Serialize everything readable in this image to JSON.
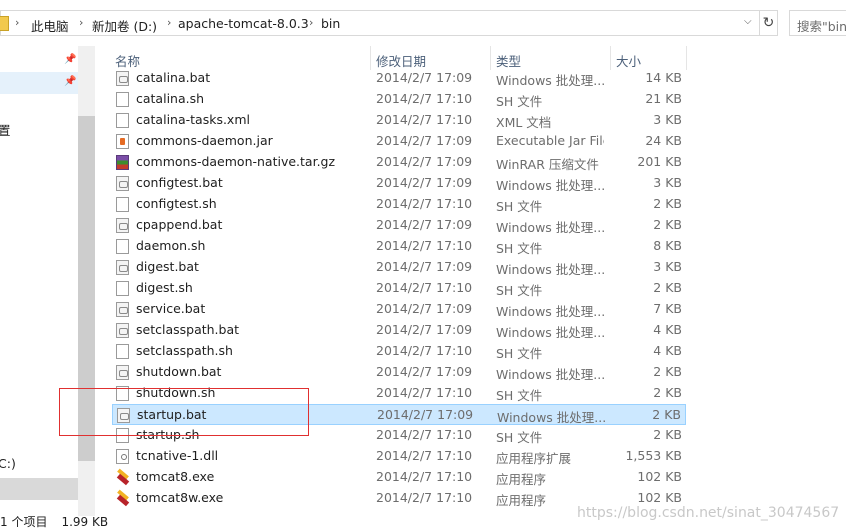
{
  "address": {
    "crumbs": [
      "此电脑",
      "新加卷 (D:)",
      "apache-tomcat-8.0.3",
      "bin"
    ],
    "refresh_glyph": "↻",
    "dropdown_glyph": "⌵",
    "search_placeholder": "搜索\"bin\""
  },
  "nav": {
    "items": [
      {
        "label": "",
        "pinned": true
      },
      {
        "label": "",
        "pinned": true
      },
      {
        "label": "置",
        "pinned": false
      },
      {
        "label": "C:)",
        "pinned": false
      },
      {
        "label": "",
        "pinned": false
      }
    ],
    "pin_glyph": "📌"
  },
  "status": {
    "item_count": "1 个项目",
    "selected_size": "1.99 KB"
  },
  "columns": {
    "name": "名称",
    "date": "修改日期",
    "type": "类型",
    "size": "大小"
  },
  "files": [
    {
      "name": "catalina.bat",
      "date": "2014/2/7 17:09",
      "type": "Windows 批处理...",
      "size": "14 KB",
      "icon": "bat"
    },
    {
      "name": "catalina.sh",
      "date": "2014/2/7 17:10",
      "type": "SH 文件",
      "size": "21 KB",
      "icon": "doc"
    },
    {
      "name": "catalina-tasks.xml",
      "date": "2014/2/7 17:10",
      "type": "XML 文档",
      "size": "3 KB",
      "icon": "doc"
    },
    {
      "name": "commons-daemon.jar",
      "date": "2014/2/7 17:09",
      "type": "Executable Jar File",
      "size": "24 KB",
      "icon": "jar"
    },
    {
      "name": "commons-daemon-native.tar.gz",
      "date": "2014/2/7 17:09",
      "type": "WinRAR 压缩文件",
      "size": "201 KB",
      "icon": "rar"
    },
    {
      "name": "configtest.bat",
      "date": "2014/2/7 17:09",
      "type": "Windows 批处理...",
      "size": "3 KB",
      "icon": "bat"
    },
    {
      "name": "configtest.sh",
      "date": "2014/2/7 17:10",
      "type": "SH 文件",
      "size": "2 KB",
      "icon": "doc"
    },
    {
      "name": "cpappend.bat",
      "date": "2014/2/7 17:09",
      "type": "Windows 批处理...",
      "size": "2 KB",
      "icon": "bat"
    },
    {
      "name": "daemon.sh",
      "date": "2014/2/7 17:10",
      "type": "SH 文件",
      "size": "8 KB",
      "icon": "doc"
    },
    {
      "name": "digest.bat",
      "date": "2014/2/7 17:09",
      "type": "Windows 批处理...",
      "size": "3 KB",
      "icon": "bat"
    },
    {
      "name": "digest.sh",
      "date": "2014/2/7 17:10",
      "type": "SH 文件",
      "size": "2 KB",
      "icon": "doc"
    },
    {
      "name": "service.bat",
      "date": "2014/2/7 17:09",
      "type": "Windows 批处理...",
      "size": "7 KB",
      "icon": "bat"
    },
    {
      "name": "setclasspath.bat",
      "date": "2014/2/7 17:09",
      "type": "Windows 批处理...",
      "size": "4 KB",
      "icon": "bat"
    },
    {
      "name": "setclasspath.sh",
      "date": "2014/2/7 17:10",
      "type": "SH 文件",
      "size": "4 KB",
      "icon": "doc"
    },
    {
      "name": "shutdown.bat",
      "date": "2014/2/7 17:09",
      "type": "Windows 批处理...",
      "size": "2 KB",
      "icon": "bat"
    },
    {
      "name": "shutdown.sh",
      "date": "2014/2/7 17:10",
      "type": "SH 文件",
      "size": "2 KB",
      "icon": "doc"
    },
    {
      "name": "startup.bat",
      "date": "2014/2/7 17:09",
      "type": "Windows 批处理...",
      "size": "2 KB",
      "icon": "bat",
      "selected": true
    },
    {
      "name": "startup.sh",
      "date": "2014/2/7 17:10",
      "type": "SH 文件",
      "size": "2 KB",
      "icon": "doc"
    },
    {
      "name": "tcnative-1.dll",
      "date": "2014/2/7 17:10",
      "type": "应用程序扩展",
      "size": "1,553 KB",
      "icon": "dll"
    },
    {
      "name": "tomcat8.exe",
      "date": "2014/2/7 17:10",
      "type": "应用程序",
      "size": "102 KB",
      "icon": "exe"
    },
    {
      "name": "tomcat8w.exe",
      "date": "2014/2/7 17:10",
      "type": "应用程序",
      "size": "102 KB",
      "icon": "exe"
    }
  ],
  "watermark": "https://blog.csdn.net/sinat_30474567",
  "colors": {
    "selection_bg": "#cce8ff",
    "selection_border": "#99d1ff",
    "annotation_red": "#e03030",
    "header_text": "#4c607a"
  }
}
